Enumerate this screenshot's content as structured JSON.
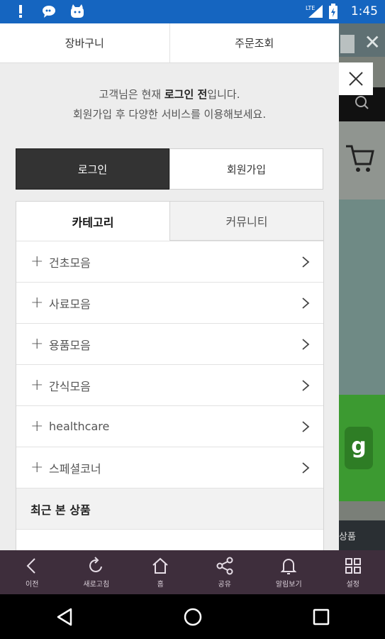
{
  "statusbar": {
    "time": "1:45",
    "network": "LTE"
  },
  "drawer": {
    "topnav": [
      {
        "label": "장바구니"
      },
      {
        "label": "주문조회"
      }
    ],
    "message": {
      "line1_pre": "고객님은 현재 ",
      "line1_bold": "로그인 전",
      "line1_post": "입니다.",
      "line2": "회원가입 후 다양한 서비스를 이용해보세요."
    },
    "auth": {
      "login_label": "로그인",
      "join_label": "회원가입"
    },
    "cattabs": [
      {
        "label": "카테고리"
      },
      {
        "label": "커뮤니티"
      }
    ],
    "categories": [
      {
        "label": "건초모음"
      },
      {
        "label": "사료모음"
      },
      {
        "label": "용품모음"
      },
      {
        "label": "간식모음"
      },
      {
        "label": "healthcare"
      },
      {
        "label": "스페셜코너"
      }
    ],
    "recent_title": "최근 본 상품"
  },
  "background": {
    "badge_text": "g",
    "bottom_text": "상품"
  },
  "toolbar": [
    {
      "label": "이전",
      "icon": "back-icon"
    },
    {
      "label": "새로고침",
      "icon": "refresh-icon"
    },
    {
      "label": "홈",
      "icon": "home-icon"
    },
    {
      "label": "공유",
      "icon": "share-icon"
    },
    {
      "label": "알림보기",
      "icon": "bell-icon"
    },
    {
      "label": "설정",
      "icon": "grid-icon"
    }
  ],
  "colors": {
    "statusbar": "#1565c0",
    "toolbar": "#3e2e3c",
    "login_button": "#333333"
  }
}
